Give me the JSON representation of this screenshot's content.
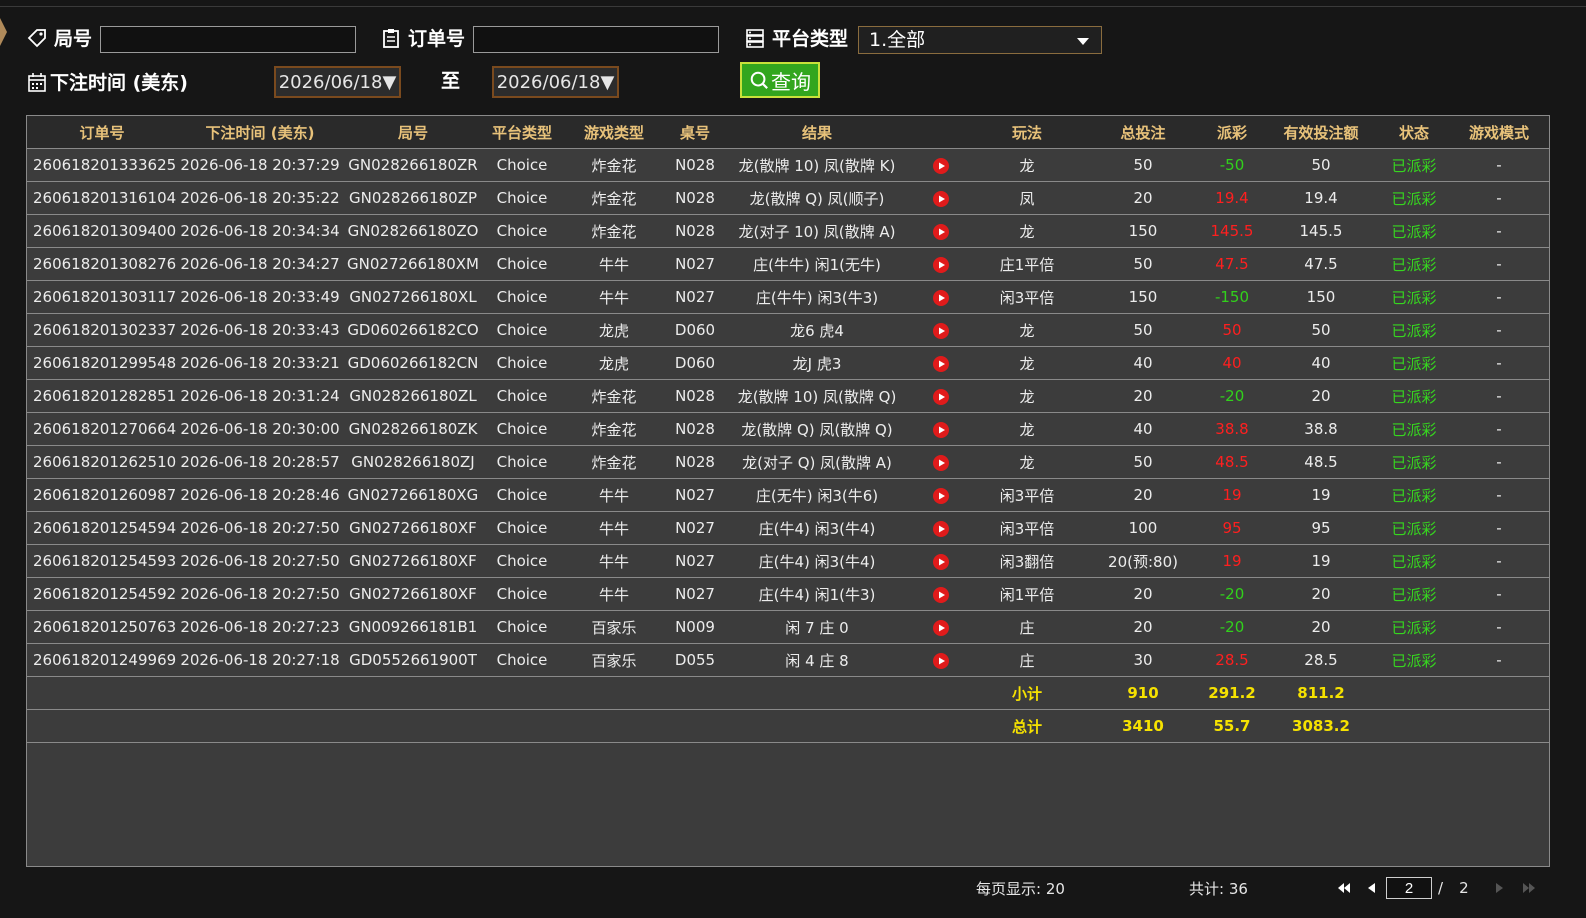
{
  "filters": {
    "round_label": "局号",
    "round_value": "",
    "order_label": "订单号",
    "order_value": "",
    "platform_label": "平台类型",
    "platform_value": "1.全部",
    "time_label": "下注时间 (美东)",
    "date_from": "2026/06/18▼",
    "to_label": "至",
    "date_to": "2026/06/18▼",
    "query_label": "查询"
  },
  "table": {
    "headers": [
      "订单号",
      "下注时间 (美东)",
      "局号",
      "平台类型",
      "游戏类型",
      "桌号",
      "结果",
      "玩法",
      "总投注",
      "派彩",
      "有效投注额",
      "状态",
      "游戏模式"
    ],
    "rows": [
      {
        "order": "260618201333625",
        "time": "2026-06-18 20:37:29",
        "round": "GN028266180ZR",
        "platform": "Choice",
        "game": "炸金花",
        "table": "N028",
        "result": "龙(散牌 10) 凤(散牌 K)",
        "play": "龙",
        "bet": "50",
        "payout": "-50",
        "payout_type": "neg",
        "valid": "50",
        "status": "已派彩",
        "mode": "-"
      },
      {
        "order": "260618201316104",
        "time": "2026-06-18 20:35:22",
        "round": "GN028266180ZP",
        "platform": "Choice",
        "game": "炸金花",
        "table": "N028",
        "result": "龙(散牌 Q) 凤(顺子)",
        "play": "凤",
        "bet": "20",
        "payout": "19.4",
        "payout_type": "pos",
        "valid": "19.4",
        "status": "已派彩",
        "mode": "-"
      },
      {
        "order": "260618201309400",
        "time": "2026-06-18 20:34:34",
        "round": "GN028266180ZO",
        "platform": "Choice",
        "game": "炸金花",
        "table": "N028",
        "result": "龙(对子 10) 凤(散牌 A)",
        "play": "龙",
        "bet": "150",
        "payout": "145.5",
        "payout_type": "pos",
        "valid": "145.5",
        "status": "已派彩",
        "mode": "-"
      },
      {
        "order": "260618201308276",
        "time": "2026-06-18 20:34:27",
        "round": "GN027266180XM",
        "platform": "Choice",
        "game": "牛牛",
        "table": "N027",
        "result": "庄(牛牛) 闲1(无牛)",
        "play": "庄1平倍",
        "bet": "50",
        "payout": "47.5",
        "payout_type": "pos",
        "valid": "47.5",
        "status": "已派彩",
        "mode": "-"
      },
      {
        "order": "260618201303117",
        "time": "2026-06-18 20:33:49",
        "round": "GN027266180XL",
        "platform": "Choice",
        "game": "牛牛",
        "table": "N027",
        "result": "庄(牛牛) 闲3(牛3)",
        "play": "闲3平倍",
        "bet": "150",
        "payout": "-150",
        "payout_type": "neg",
        "valid": "150",
        "status": "已派彩",
        "mode": "-"
      },
      {
        "order": "260618201302337",
        "time": "2026-06-18 20:33:43",
        "round": "GD060266182CO",
        "platform": "Choice",
        "game": "龙虎",
        "table": "D060",
        "result": "龙6 虎4",
        "play": "龙",
        "bet": "50",
        "payout": "50",
        "payout_type": "pos",
        "valid": "50",
        "status": "已派彩",
        "mode": "-"
      },
      {
        "order": "260618201299548",
        "time": "2026-06-18 20:33:21",
        "round": "GD060266182CN",
        "platform": "Choice",
        "game": "龙虎",
        "table": "D060",
        "result": "龙J 虎3",
        "play": "龙",
        "bet": "40",
        "payout": "40",
        "payout_type": "pos",
        "valid": "40",
        "status": "已派彩",
        "mode": "-"
      },
      {
        "order": "260618201282851",
        "time": "2026-06-18 20:31:24",
        "round": "GN028266180ZL",
        "platform": "Choice",
        "game": "炸金花",
        "table": "N028",
        "result": "龙(散牌 10) 凤(散牌 Q)",
        "play": "龙",
        "bet": "20",
        "payout": "-20",
        "payout_type": "neg",
        "valid": "20",
        "status": "已派彩",
        "mode": "-"
      },
      {
        "order": "260618201270664",
        "time": "2026-06-18 20:30:00",
        "round": "GN028266180ZK",
        "platform": "Choice",
        "game": "炸金花",
        "table": "N028",
        "result": "龙(散牌 Q) 凤(散牌 Q)",
        "play": "龙",
        "bet": "40",
        "payout": "38.8",
        "payout_type": "pos",
        "valid": "38.8",
        "status": "已派彩",
        "mode": "-"
      },
      {
        "order": "260618201262510",
        "time": "2026-06-18 20:28:57",
        "round": "GN028266180ZJ",
        "platform": "Choice",
        "game": "炸金花",
        "table": "N028",
        "result": "龙(对子 Q) 凤(散牌 A)",
        "play": "龙",
        "bet": "50",
        "payout": "48.5",
        "payout_type": "pos",
        "valid": "48.5",
        "status": "已派彩",
        "mode": "-"
      },
      {
        "order": "260618201260987",
        "time": "2026-06-18 20:28:46",
        "round": "GN027266180XG",
        "platform": "Choice",
        "game": "牛牛",
        "table": "N027",
        "result": "庄(无牛) 闲3(牛6)",
        "play": "闲3平倍",
        "bet": "20",
        "payout": "19",
        "payout_type": "pos",
        "valid": "19",
        "status": "已派彩",
        "mode": "-"
      },
      {
        "order": "260618201254594",
        "time": "2026-06-18 20:27:50",
        "round": "GN027266180XF",
        "platform": "Choice",
        "game": "牛牛",
        "table": "N027",
        "result": "庄(牛4) 闲3(牛4)",
        "play": "闲3平倍",
        "bet": "100",
        "payout": "95",
        "payout_type": "pos",
        "valid": "95",
        "status": "已派彩",
        "mode": "-"
      },
      {
        "order": "260618201254593",
        "time": "2026-06-18 20:27:50",
        "round": "GN027266180XF",
        "platform": "Choice",
        "game": "牛牛",
        "table": "N027",
        "result": "庄(牛4) 闲3(牛4)",
        "play": "闲3翻倍",
        "bet": "20(预:80)",
        "payout": "19",
        "payout_type": "pos",
        "valid": "19",
        "status": "已派彩",
        "mode": "-"
      },
      {
        "order": "260618201254592",
        "time": "2026-06-18 20:27:50",
        "round": "GN027266180XF",
        "platform": "Choice",
        "game": "牛牛",
        "table": "N027",
        "result": "庄(牛4) 闲1(牛3)",
        "play": "闲1平倍",
        "bet": "20",
        "payout": "-20",
        "payout_type": "neg",
        "valid": "20",
        "status": "已派彩",
        "mode": "-"
      },
      {
        "order": "260618201250763",
        "time": "2026-06-18 20:27:23",
        "round": "GN009266181B1",
        "platform": "Choice",
        "game": "百家乐",
        "table": "N009",
        "result": "闲 7 庄 0",
        "play": "庄",
        "bet": "20",
        "payout": "-20",
        "payout_type": "neg",
        "valid": "20",
        "status": "已派彩",
        "mode": "-"
      },
      {
        "order": "260618201249969",
        "time": "2026-06-18 20:27:18",
        "round": "GD0552661900T",
        "platform": "Choice",
        "game": "百家乐",
        "table": "D055",
        "result": "闲 4 庄 8",
        "play": "庄",
        "bet": "30",
        "payout": "28.5",
        "payout_type": "pos",
        "valid": "28.5",
        "status": "已派彩",
        "mode": "-"
      }
    ],
    "subtotal": {
      "label": "小计",
      "bet": "910",
      "payout": "291.2",
      "valid": "811.2"
    },
    "total": {
      "label": "总计",
      "bet": "3410",
      "payout": "55.7",
      "valid": "3083.2"
    }
  },
  "footer": {
    "per_page": "每页显示: 20",
    "total_count": "共计: 36",
    "current_page": "2",
    "separator": "/",
    "total_pages": "2"
  },
  "colors": {
    "header_text": "#e8c27a",
    "negative_payout": "#31d11b",
    "positive_payout": "#ff1f1f",
    "status_paid": "#36d61f",
    "summary_text": "#f6e200",
    "query_button": "#32a61e"
  }
}
